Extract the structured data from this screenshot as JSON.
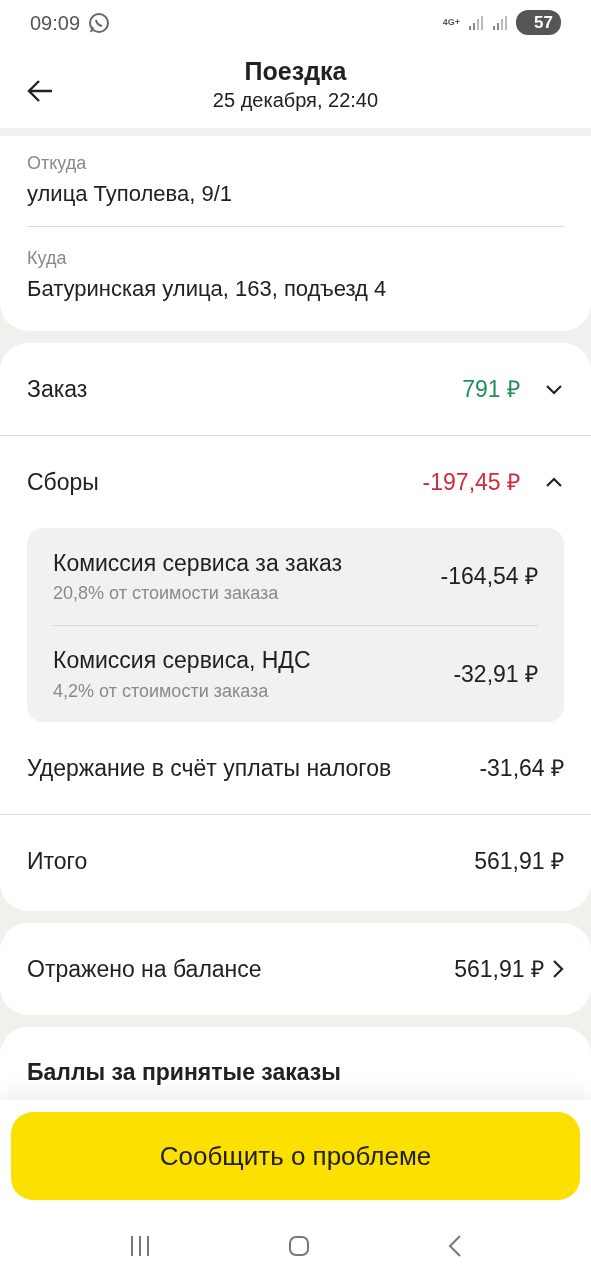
{
  "status_bar": {
    "time": "09:09",
    "network": "4G+",
    "battery": "57"
  },
  "header": {
    "title": "Поездка",
    "subtitle": "25 декабря, 22:40"
  },
  "route": [
    {
      "label": "Откуда",
      "value": "улица Туполева, 9/1"
    },
    {
      "label": "Куда",
      "value": "Батуринская улица, 163, подъезд 4"
    }
  ],
  "summary": [
    {
      "kind": "expandable",
      "label": "Заказ",
      "amount": "791 ₽",
      "color": "#21915b",
      "expanded": false
    },
    {
      "kind": "expandable",
      "label": "Сборы",
      "amount": "-197,45 ₽",
      "color": "#d22c3a",
      "expanded": true,
      "items": [
        {
          "title": "Комиссия сервиса за заказ",
          "note": "20,8% от стоимости заказа",
          "amount": "-164,54 ₽"
        },
        {
          "title": "Комиссия сервиса, НДС",
          "note": "4,2% от стоимости заказа",
          "amount": "-32,91 ₽"
        }
      ]
    },
    {
      "kind": "plain",
      "label": "Удержание в счёт уплаты налогов",
      "amount": "-31,64 ₽",
      "color": "#212121"
    },
    {
      "kind": "total",
      "label": "Итого",
      "amount": "561,91 ₽",
      "color": "#212121"
    }
  ],
  "balance": {
    "label": "Отражено на балансе",
    "amount": "561,91 ₽"
  },
  "points": {
    "title": "Баллы за принятые заказы"
  },
  "button": "Сообщить о проблеме"
}
